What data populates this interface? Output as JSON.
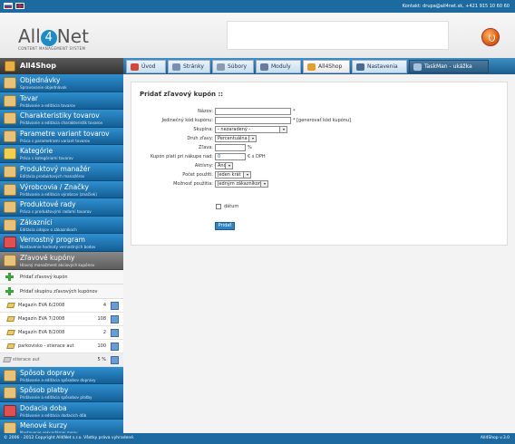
{
  "topbar": {
    "contact": "Kontakt: drupa@all4net.sk, +421 915 10 60 60",
    "flags": [
      "slovak-flag-icon",
      "uk-flag-icon"
    ]
  },
  "header": {
    "logo_main_left": "All",
    "logo_main_digit": "4",
    "logo_main_right": "Net",
    "logo_sub": "CONTENT MANAGEMENT SYSTEM"
  },
  "nav": {
    "section": "All4Shop",
    "tabs": [
      {
        "label": "Úvod",
        "icon": "home-icon"
      },
      {
        "label": "Stránky",
        "icon": "pages-icon"
      },
      {
        "label": "Súbory",
        "icon": "files-icon"
      },
      {
        "label": "Moduly",
        "icon": "modules-icon"
      },
      {
        "label": "All4Shop",
        "icon": "shop-icon"
      },
      {
        "label": "Nastavenia",
        "icon": "settings-icon"
      },
      {
        "label": "TaskMan - ukážka",
        "icon": "taskman-icon"
      }
    ]
  },
  "sidebar": {
    "items": [
      {
        "title": "Objednávky",
        "sub": "Spravovanie objednávok"
      },
      {
        "title": "Tovar",
        "sub": "Pridávanie a editácia tovarov"
      },
      {
        "title": "Charakteristiky tovarov",
        "sub": "Pridávanie a editácia charakteristík tovarov"
      },
      {
        "title": "Parametre variant tovarov",
        "sub": "Práca s parametrami variant tovarov"
      },
      {
        "title": "Kategórie",
        "sub": "Práca s kategóriami tovarov"
      },
      {
        "title": "Produktový manažér",
        "sub": "Editácia produktových manažérov"
      },
      {
        "title": "Výrobcovia / Značky",
        "sub": "Pridávanie a editácia výrobcov (značiek)"
      },
      {
        "title": "Produktové rady",
        "sub": "Práca s produktovými radami tovarov"
      },
      {
        "title": "Zákazníci",
        "sub": "Editácia údajov o zákazníkoch"
      },
      {
        "title": "Vernostný program",
        "sub": "Nastavenie hodnoty vernostných bodov"
      },
      {
        "title": "Zľavové kupóny",
        "sub": "Hlavný manažment akciových kupónov"
      }
    ],
    "actions": [
      {
        "label": "Pridať zľavový kupón"
      },
      {
        "label": "Pridať skupinu zľavových kupónov"
      }
    ],
    "coupons": [
      {
        "name": "Magazín EVA 6/2008",
        "value": "4"
      },
      {
        "name": "Magazín EVA 7/2008",
        "value": "108"
      },
      {
        "name": "Magazín EVA 8/2008",
        "value": "2"
      },
      {
        "name": "parkovisko - stierace aut",
        "value": "100"
      },
      {
        "name": "stierace aut",
        "value": "5 %"
      }
    ],
    "bottom_items": [
      {
        "title": "Spôsob dopravy",
        "sub": "Pridávanie a editácia spôsobov dopravy"
      },
      {
        "title": "Spôsob platby",
        "sub": "Pridávanie a editácia spôsobov platby"
      },
      {
        "title": "Dodacia doba",
        "sub": "Pridávanie a editácia dodacích dôb"
      },
      {
        "title": "Menové kurzy",
        "sub": "Nastavenie sekundárnej meny"
      }
    ]
  },
  "form": {
    "title": "Pridať zľavový kupón ::",
    "fields": {
      "nazov": {
        "label": "Názov:",
        "value": "",
        "note": "*"
      },
      "kod": {
        "label": "Jedinečný kód kupónu:",
        "value": "",
        "note": "* [generovať kód kupónu]"
      },
      "skupina": {
        "label": "Skupina:",
        "value": "- nezaradený -"
      },
      "druh": {
        "label": "Druh zľavy:",
        "value": "Percentuálna"
      },
      "zlava": {
        "label": "Zľava:",
        "value": "",
        "note": "%"
      },
      "nakup": {
        "label": "Kupón platí pri nákupe nad:",
        "value": "0",
        "note": "€ s DPH"
      },
      "aktivny": {
        "label": "Aktívny:",
        "value": "Áno"
      },
      "pocet": {
        "label": "Počet použití:",
        "value": "Jeden krát"
      },
      "moznost": {
        "label": "Možnosť použitia:",
        "value": "Jedným zákazníkom"
      }
    },
    "checkbox_label": "dátum",
    "submit": "Pridať"
  },
  "footer": {
    "left": "© 2006 - 2012 Copyright All4Net s.r.o. Všetky práva vyhradené.",
    "right": "All4Shop v.3.0"
  }
}
